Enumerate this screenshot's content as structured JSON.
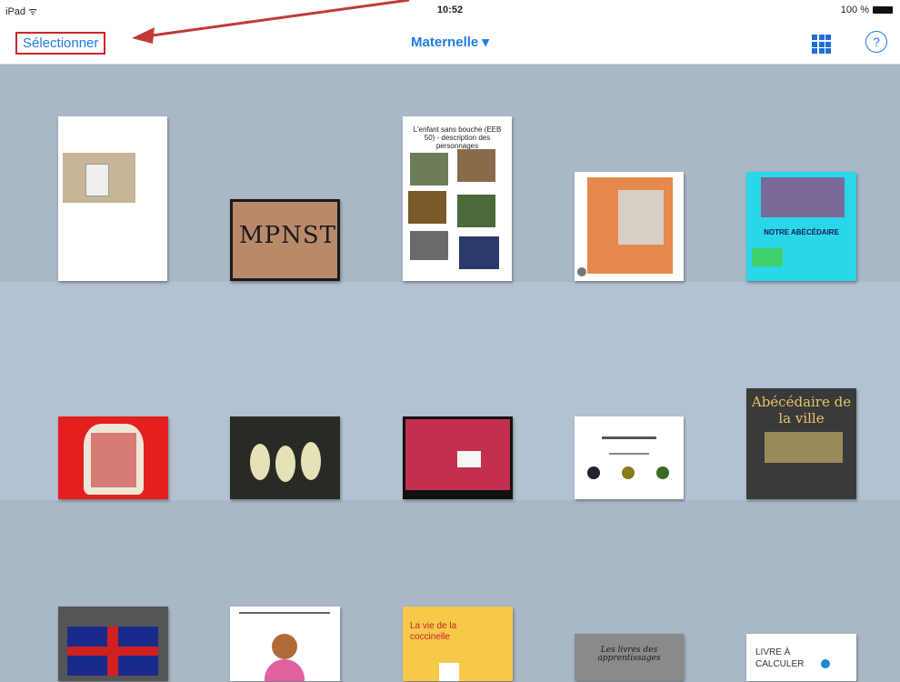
{
  "status": {
    "device": "iPad ᯤ",
    "time": "10:52",
    "battery_percent": "100 %"
  },
  "nav": {
    "select_label": "Sélectionner",
    "library_title": "Maternelle ▾"
  },
  "icons": {
    "grid": "grid-view-icon",
    "help": "help-icon",
    "help_glyph": "?"
  },
  "books": {
    "b3": "L'enfant sans bouche (EEB 50) - description des personnages",
    "b4": "NOTRE ABÉCÉDAIRE",
    "b5": "Abécédaire de la ville",
    "b6": "La vie de la coccinelle",
    "b7": "LIVRE À CALCULER",
    "b8": "Les livres des apprentissages"
  },
  "colors": {
    "accent": "#1f7be0",
    "highlight": "#d0262b",
    "shelf": "#a9b7c7"
  }
}
